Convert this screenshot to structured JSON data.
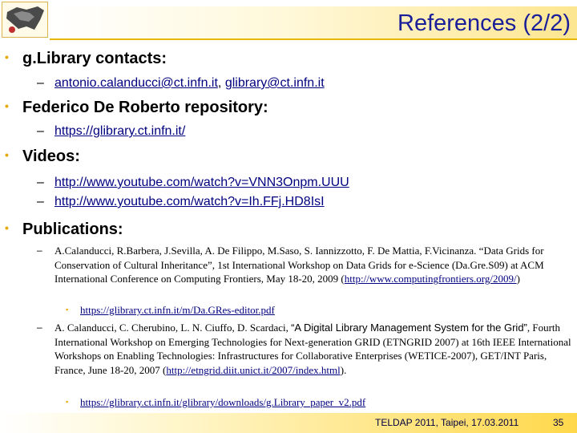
{
  "header": {
    "title": "References (2/2)"
  },
  "sections": {
    "contacts": {
      "heading": "g.Library contacts:",
      "link1": "antonio.calanducci@ct.infn.it",
      "sep": ", ",
      "link2": "glibrary@ct.infn.it"
    },
    "repository": {
      "heading": "Federico De Roberto repository:",
      "link": "https://glibrary.ct.infn.it/"
    },
    "videos": {
      "heading": "Videos:",
      "link1": "http://www.youtube.com/watch?v=VNN3Onpm.UUU",
      "link2": "http://www.youtube.com/watch?v=Ih.FFj.HD8IsI"
    },
    "publications": {
      "heading": "Publications:",
      "pub1": {
        "text_a": "A.Calanducci, R.Barbera, J.Sevilla, A. De Filippo, M.Saso, S. Iannizzotto, F. De Mattia, F.Vicinanza. “Data Grids for Conservation of Cultural Inheritance”, 1st International Workshop on Data Grids for e-Science (Da.Gre.S09) at ACM International Conference on Computing Frontiers, May 18-20, 2009 (",
        "url": "http://www.computingfrontiers.org/2009/",
        "text_b": ")",
        "sub_link": "https://glibrary.ct.infn.it/m/Da.GRes-editor.pdf"
      },
      "pub2": {
        "text_a": "A. Calanducci, C. Cherubino, L. N. Ciuffo, D. Scardaci, ",
        "title": "“A Digital Library Management System for the Grid”",
        "text_b": ", Fourth International Workshop on Emerging Technologies for Next-generation GRID (ETNGRID 2007) at 16th IEEE International Workshops on Enabling Technologies: Infrastructures for Collaborative Enterprises (WETICE-2007), GET/INT Paris, France, June 18-20, 2007 (",
        "url": "http://etngrid.diit.unict.it/2007/index.html",
        "text_c": ").",
        "sub_link": "https://glibrary.ct.infn.it/glibrary/downloads/g.Library_paper_v2.pdf"
      }
    }
  },
  "symbols": {
    "bullet": "•",
    "dash": "–",
    "sub_bullet": "▪"
  },
  "footer": {
    "event": "TELDAP 2011, Taipei, 17.03.2011",
    "page": "35"
  },
  "colors": {
    "title": "#1a1f99",
    "accent": "#e6a800",
    "link": "#000080"
  },
  "icons": {
    "logo": "sicily-map-logo"
  }
}
